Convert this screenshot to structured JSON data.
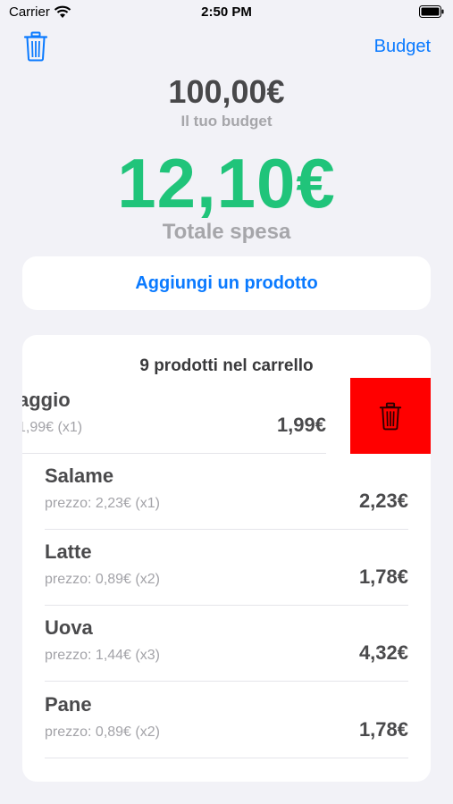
{
  "status_bar": {
    "carrier": "Carrier",
    "time": "2:50 PM"
  },
  "nav": {
    "budget_label": "Budget"
  },
  "summary": {
    "budget_amount": "100,00€",
    "budget_label": "Il tuo budget",
    "total_amount": "12,10€",
    "total_label": "Totale spesa",
    "total_color": "#20c47a"
  },
  "actions": {
    "add_product": "Aggiungi un prodotto"
  },
  "cart": {
    "header": "9 prodotti nel carrello",
    "items": [
      {
        "name": "aggio",
        "detail": "1,99€ (x1)",
        "price": "1,99€"
      },
      {
        "name": "Salame",
        "detail": "prezzo: 2,23€ (x1)",
        "price": "2,23€"
      },
      {
        "name": "Latte",
        "detail": "prezzo: 0,89€ (x2)",
        "price": "1,78€"
      },
      {
        "name": "Uova",
        "detail": "prezzo: 1,44€ (x3)",
        "price": "4,32€"
      },
      {
        "name": "Pane",
        "detail": "prezzo: 0,89€ (x2)",
        "price": "1,78€"
      }
    ],
    "delete_color": "#ff0000"
  },
  "icons": {
    "nav_trash": "trash-icon",
    "row_delete": "trash-icon"
  }
}
